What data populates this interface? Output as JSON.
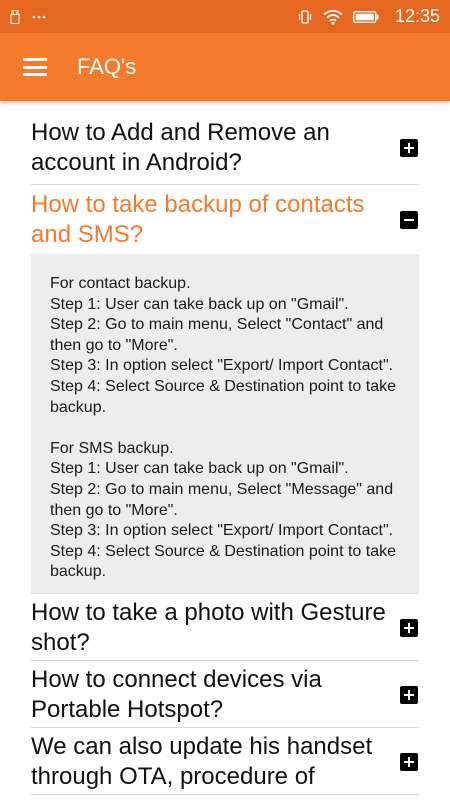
{
  "status": {
    "time": "12:35",
    "icons": [
      "usb-icon",
      "dots-icon",
      "vibrate-icon",
      "wifi-icon",
      "battery-icon"
    ]
  },
  "app_bar": {
    "title": "FAQ's",
    "menu_icon": "hamburger-menu-icon"
  },
  "colors": {
    "status_bar": "#e5671f",
    "app_bar": "#f47a2c",
    "accent_text": "#f47a2c",
    "answer_bg": "#ededed"
  },
  "faqs": [
    {
      "question": "How to Add and Remove an account in Android?",
      "expanded": false,
      "toggle_icon": "plus-box-icon"
    },
    {
      "question": "How to take backup of contacts and SMS?",
      "expanded": true,
      "toggle_icon": "minus-box-icon",
      "answer": [
        "For contact backup.",
        "Step 1: User can take back up on \"Gmail\".",
        "Step 2: Go to main menu, Select \"Contact\" and then go to \"More\".",
        "Step 3: In option select \"Export/ Import Contact\".",
        "Step 4: Select Source & Destination point to take backup.",
        "",
        "For SMS backup.",
        "Step 1: User can take back up on \"Gmail\".",
        "Step 2: Go to main menu, Select \"Message\" and then go to \"More\".",
        "Step 3: In option select \"Export/ Import Contact\".",
        "Step 4: Select Source & Destination point to take backup."
      ]
    },
    {
      "question": "How to take a photo with Gesture shot?",
      "expanded": false,
      "toggle_icon": "plus-box-icon"
    },
    {
      "question": "How to connect devices via Portable Hotspot?",
      "expanded": false,
      "toggle_icon": "plus-box-icon"
    },
    {
      "question": "We can also update his handset through OTA, procedure of",
      "expanded": false,
      "toggle_icon": "plus-box-icon"
    }
  ]
}
